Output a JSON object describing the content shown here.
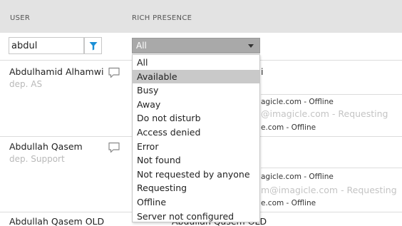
{
  "header": {
    "user_label": "USER",
    "rich_presence_label": "RICH PRESENCE"
  },
  "filters": {
    "search_value": "abdul",
    "filter_icon": "filter-funnel-icon",
    "presence_select_value": "All"
  },
  "dropdown": {
    "options": [
      "All",
      "Available",
      "Busy",
      "Away",
      "Do not disturb",
      "Access denied",
      "Error",
      "Not found",
      "Not requested by anyone",
      "Requesting",
      "Offline",
      "Server not configured"
    ],
    "highlighted": "Available",
    "highlight_color": "#c9c9c9"
  },
  "users": [
    {
      "name": "Abdulhamid Alhamwi",
      "dept": "dep. AS",
      "rp_name_tail": "i",
      "rp_line1": "agicle.com - Offline",
      "rp_line2": "@imagicle.com - Requesting",
      "rp_line3": "e.com - Offline"
    },
    {
      "name": "Abdullah Qasem",
      "dept": "dep. Support",
      "rp_line1": "agicle.com - Offline",
      "rp_line2": "m@imagicle.com - Requesting",
      "rp_line3": "e.com - Offline"
    },
    {
      "name": "Abdullah Qasem OLD",
      "rp_name": "Abdullah Qasem OLD"
    }
  ],
  "colors": {
    "header_bg": "#e3e3e3",
    "select_bg": "#a9a9a9",
    "dept_text": "#b9b9b9",
    "filter_icon": "#1a8fd6"
  }
}
